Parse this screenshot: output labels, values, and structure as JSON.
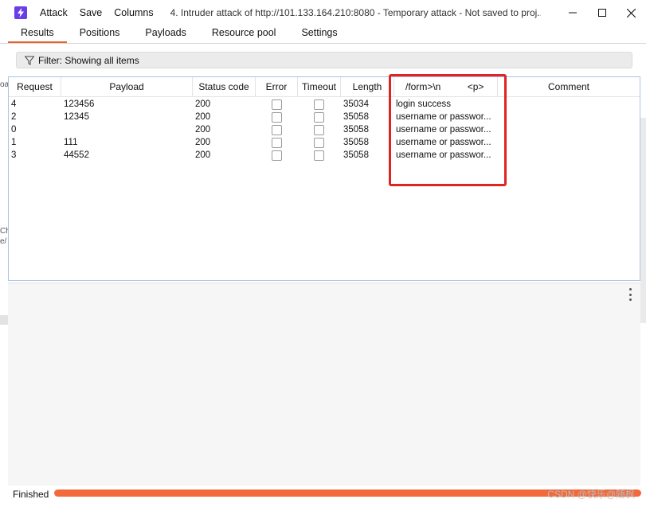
{
  "menu": [
    "Attack",
    "Save",
    "Columns"
  ],
  "window_title": "4. Intruder attack of http://101.133.164.210:8080 - Temporary attack - Not saved to proj...",
  "tabs": [
    "Results",
    "Positions",
    "Payloads",
    "Resource pool",
    "Settings"
  ],
  "active_tab": "Results",
  "filter_text": "Filter: Showing all items",
  "bg_edge_text": [
    "oa",
    "Ch",
    "e/"
  ],
  "columns": {
    "request": "Request",
    "payload": "Payload",
    "status": "Status code",
    "error": "Error",
    "timeout": "Timeout",
    "length": "Length",
    "extract": "/form>\\n          <p>",
    "comment": "Comment"
  },
  "rows": [
    {
      "request": "4",
      "payload": "123456",
      "status": "200",
      "length": "35034",
      "extract": "login success"
    },
    {
      "request": "2",
      "payload": "12345",
      "status": "200",
      "length": "35058",
      "extract": "username or passwor..."
    },
    {
      "request": "0",
      "payload": "",
      "status": "200",
      "length": "35058",
      "extract": "username or passwor..."
    },
    {
      "request": "1",
      "payload": "111",
      "status": "200",
      "length": "35058",
      "extract": "username or passwor..."
    },
    {
      "request": "3",
      "payload": "44552",
      "status": "200",
      "length": "35058",
      "extract": "username or passwor..."
    }
  ],
  "status_text": "Finished",
  "progress_fraction": 1.0,
  "watermark": "CSDN @快乐@随枫",
  "colors": {
    "accent": "#e8612c",
    "progress": "#f26a3c",
    "highlight": "#e02424",
    "app_icon": "#6a3de8"
  },
  "icons": {
    "app": "burp-lightning-icon",
    "filter": "funnel-icon",
    "more": "kebab-icon"
  }
}
